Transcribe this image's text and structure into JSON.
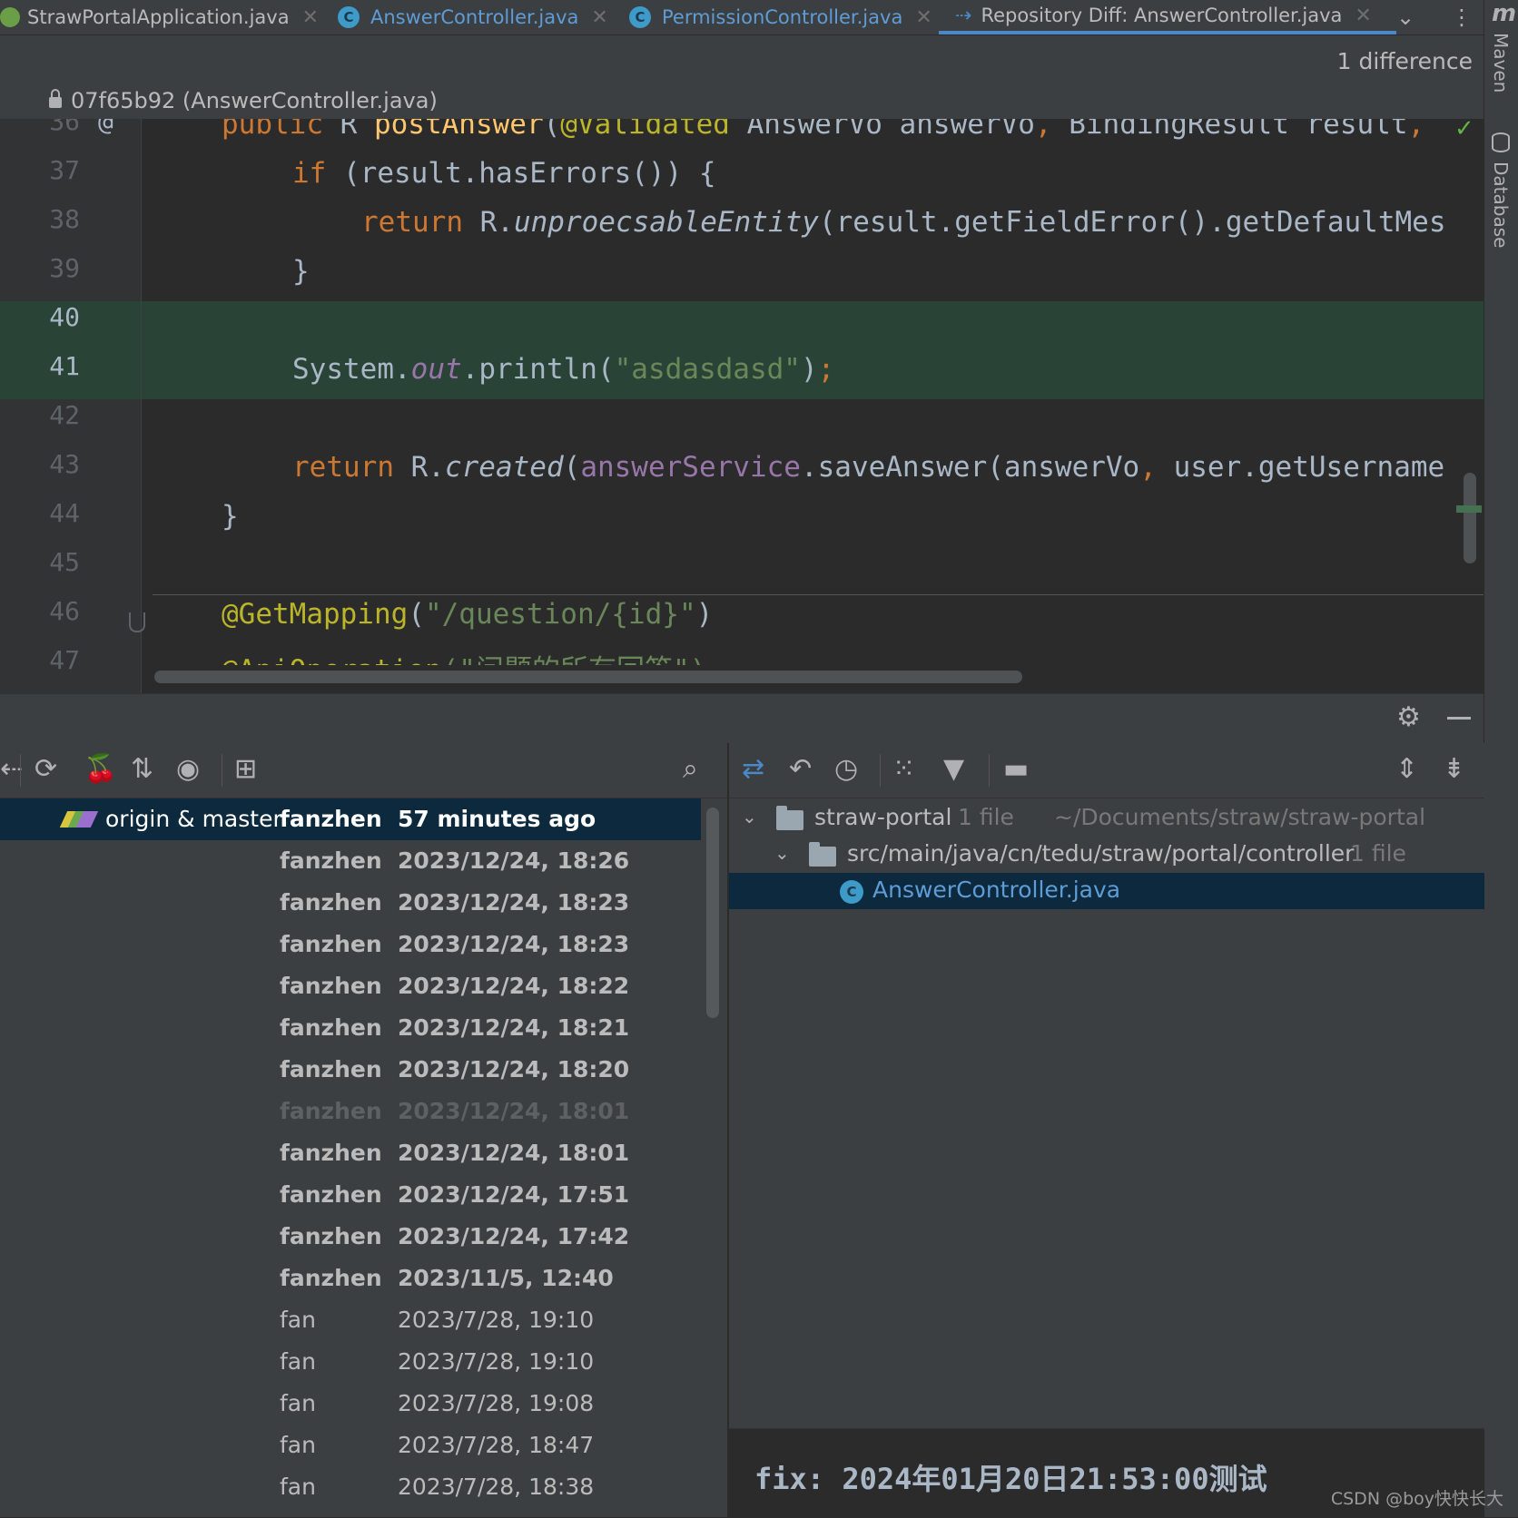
{
  "tabs": [
    {
      "label": "StrawPortalApplication.java"
    },
    {
      "label": "AnswerController.java"
    },
    {
      "label": "PermissionController.java"
    },
    {
      "label": "Repository Diff: AnswerController.java"
    }
  ],
  "sidebar": {
    "maven": "Maven",
    "database": "Database",
    "maven_logo": "m"
  },
  "diff": {
    "count": "1 difference",
    "file": "07f65b92 (AnswerController.java)"
  },
  "code": {
    "line_numbers": [
      "36",
      "37",
      "38",
      "39",
      "40",
      "41",
      "42",
      "43",
      "44",
      "45",
      "46",
      "47"
    ],
    "gutter_mark": "@",
    "l36": {
      "kw": "public",
      "t1": " R ",
      "fn": "postAnswer",
      "t2": "(",
      "ann": "@Validated",
      "t3": " AnswerVo answerVo",
      "comma": ",",
      "t4": " BindingResult result",
      "comma2": ","
    },
    "l37": {
      "kw": "if",
      "t1": " (result.hasErrors()) {"
    },
    "l38": {
      "kw": "return",
      "t1": " R.",
      "it": "unproecsableEntity",
      "t2": "(result.getFieldError().getDefaultMes"
    },
    "l39": {
      "t1": "}"
    },
    "l41": {
      "t1": "System.",
      "fld": "out",
      "t2": ".println(",
      "str": "\"asdasdasd\"",
      "t3": ")",
      "semi": ";"
    },
    "l43": {
      "kw": "return",
      "t1": " R.",
      "it": "created",
      "t2": "(",
      "ivar": "answerService",
      "t3": ".saveAnswer(answerVo",
      "comma": ",",
      "t4": " user.getUsername"
    },
    "l44": {
      "t1": "}"
    },
    "l46": {
      "ann": "@GetMapping",
      "t1": "(",
      "str": "\"/question/{id}\"",
      "t2": ")"
    },
    "l47": {
      "ann": "@ApiOperation",
      "str": "(\"问题的所有回答\")"
    }
  },
  "log": {
    "rows": [
      {
        "refs": "origin & master",
        "author": "fanzhen",
        "date": "57 minutes ago",
        "style": "bold"
      },
      {
        "author": "fanzhen",
        "date": "2023/12/24, 18:26",
        "style": "bold"
      },
      {
        "author": "fanzhen",
        "date": "2023/12/24, 18:23",
        "style": "bold"
      },
      {
        "author": "fanzhen",
        "date": "2023/12/24, 18:23",
        "style": "bold"
      },
      {
        "author": "fanzhen",
        "date": "2023/12/24, 18:22",
        "style": "bold"
      },
      {
        "author": "fanzhen",
        "date": "2023/12/24, 18:21",
        "style": "bold"
      },
      {
        "author": "fanzhen",
        "date": "2023/12/24, 18:20",
        "style": "bold"
      },
      {
        "author": "fanzhen",
        "date": "2023/12/24, 18:01",
        "style": "dim"
      },
      {
        "author": "fanzhen",
        "date": "2023/12/24, 18:01",
        "style": "bold"
      },
      {
        "author": "fanzhen",
        "date": "2023/12/24, 17:51",
        "style": "bold"
      },
      {
        "author": "fanzhen",
        "date": "2023/12/24, 17:42",
        "style": "bold"
      },
      {
        "author": "fanzhen",
        "date": "2023/11/5, 12:40",
        "style": "bold"
      },
      {
        "author": "fan",
        "date": "2023/7/28, 19:10",
        "style": "normal"
      },
      {
        "author": "fan",
        "date": "2023/7/28, 19:10",
        "style": "normal"
      },
      {
        "author": "fan",
        "date": "2023/7/28, 19:08",
        "style": "normal"
      },
      {
        "author": "fan",
        "date": "2023/7/28, 18:47",
        "style": "normal"
      },
      {
        "author": "fan",
        "date": "2023/7/28, 18:38",
        "style": "normal"
      }
    ]
  },
  "tree": {
    "root": {
      "name": "straw-portal",
      "count": "1 file",
      "path": "~/Documents/straw/straw-portal"
    },
    "dir": {
      "name": "src/main/java/cn/tedu/straw/portal/controller",
      "count": "1 file"
    },
    "file": {
      "name": "AnswerController.java"
    }
  },
  "commit_message": "fix: 2024年01月20日21:53:00测试",
  "watermark": "CSDN @boy快快长大",
  "colors": {
    "accent": "#4a88c7",
    "diff_added": "#294436",
    "selection": "#0d293e",
    "tag_yellow": "#d9c43f",
    "tag_green": "#6aa84f",
    "tag_purple": "#9b6fd0"
  }
}
